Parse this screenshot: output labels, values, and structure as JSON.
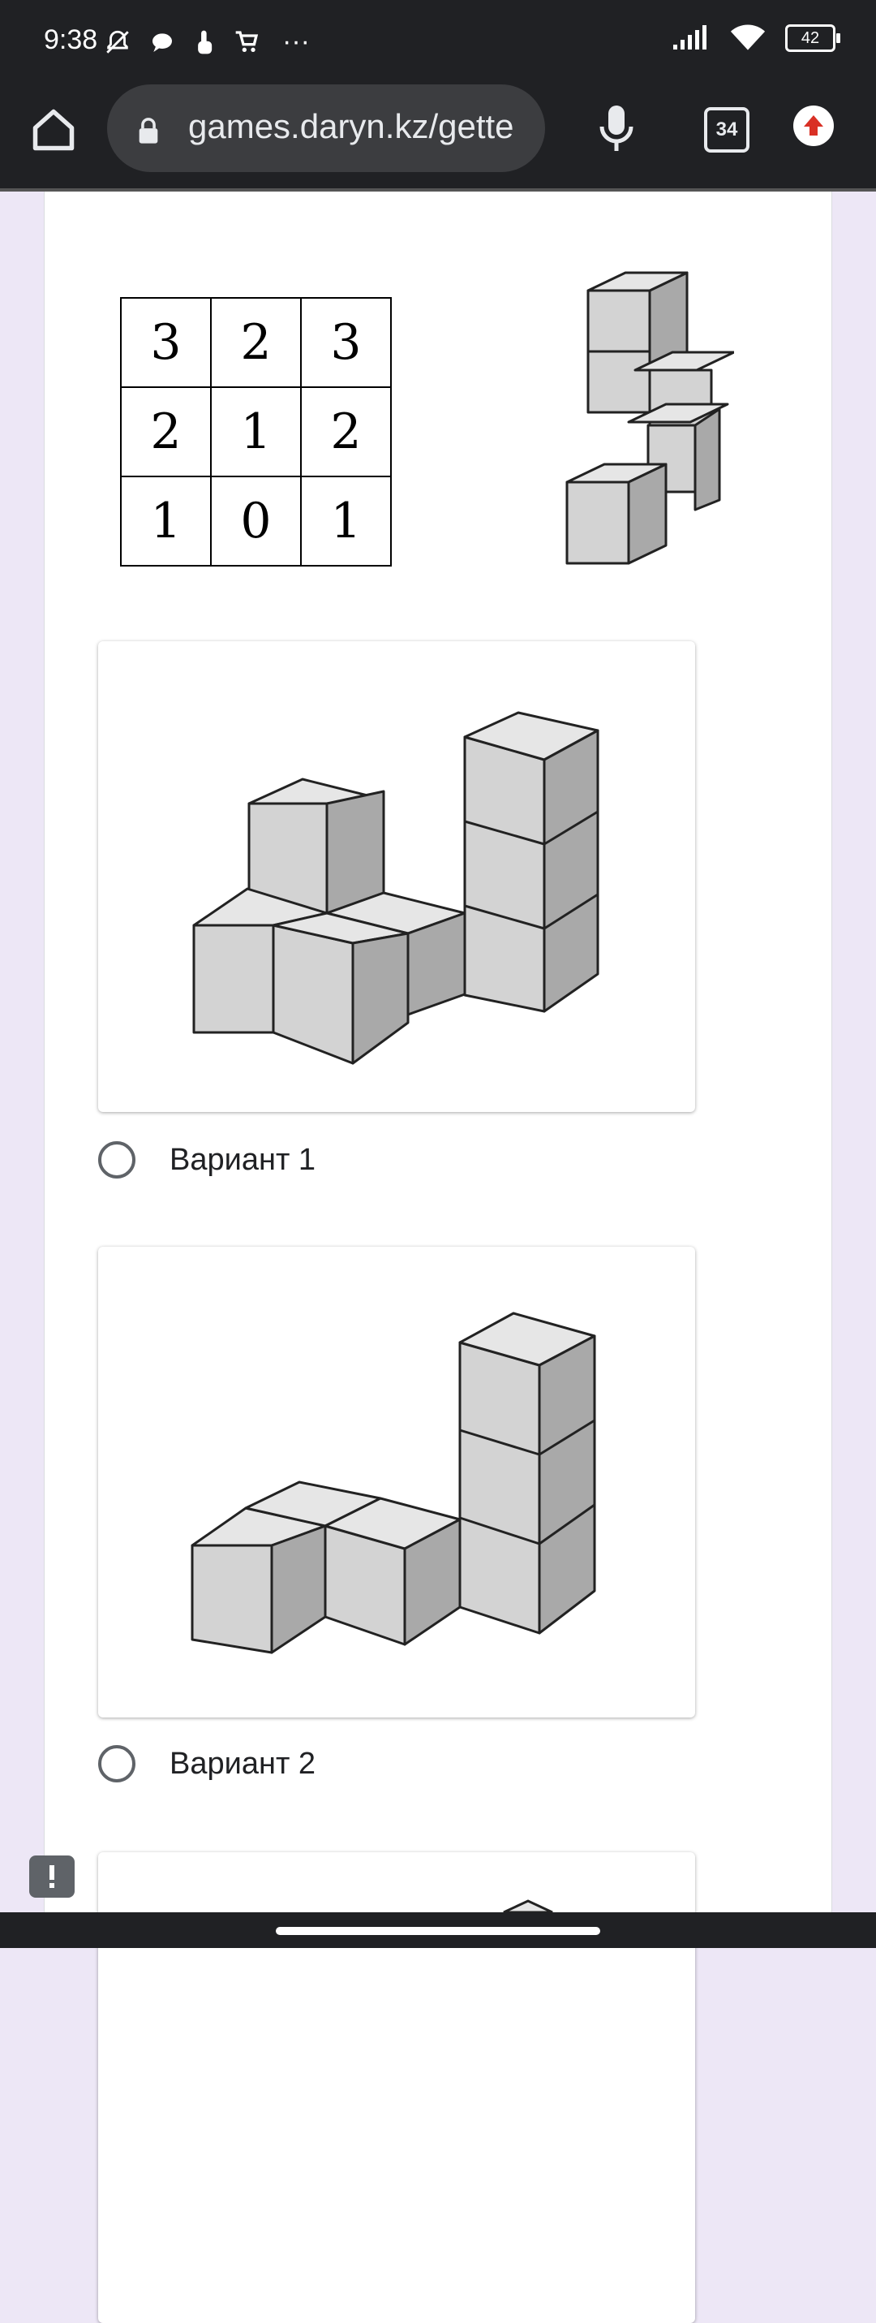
{
  "status_bar": {
    "time": "9:38",
    "more": "···",
    "battery": "42"
  },
  "browser": {
    "url": "games.daryn.kz/gette",
    "tab_count": "34"
  },
  "question": {
    "grid": [
      [
        "3",
        "2",
        "3"
      ],
      [
        "2",
        "1",
        "2"
      ],
      [
        "1",
        "0",
        "1"
      ]
    ]
  },
  "options": [
    {
      "label": "Вариант 1"
    },
    {
      "label": "Вариант 2"
    }
  ],
  "colors": {
    "cube_top": "#e6e6e6",
    "cube_front": "#d3d3d3",
    "cube_side": "#a9a9a9",
    "page_bg": "#ede7f6",
    "toolbar": "#202124"
  }
}
